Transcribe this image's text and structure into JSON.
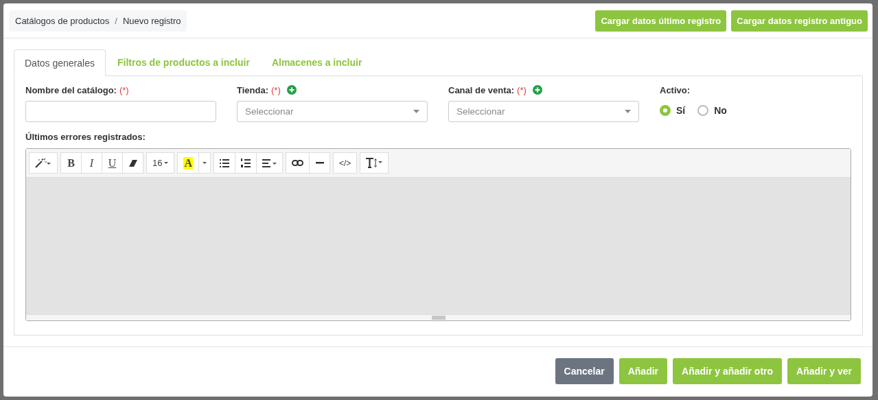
{
  "breadcrumb": [
    "Catálogos de productos",
    "Nuevo registro"
  ],
  "breadcrumb_separator": "/",
  "header_buttons": [
    "Cargar datos último registro",
    "Cargar datos registro antiguo"
  ],
  "tabs": [
    {
      "label": "Datos generales",
      "selected": true
    },
    {
      "label": "Filtros de productos a incluir",
      "selected": false
    },
    {
      "label": "Almacenes a incluir",
      "selected": false
    }
  ],
  "fields": [
    {
      "kind": "text",
      "label": "Nombre del catálogo:",
      "required": "(*)",
      "add": false
    },
    {
      "kind": "select",
      "label": "Tienda:",
      "required": "(*)",
      "add": true,
      "placeholder": "Seleccionar"
    },
    {
      "kind": "select",
      "label": "Canal de venta:",
      "required": "(*)",
      "add": true,
      "placeholder": "Seleccionar"
    },
    {
      "kind": "radio",
      "label": "Activo:",
      "options": [
        {
          "label": "Sí",
          "selected": true
        },
        {
          "label": "No",
          "selected": false
        }
      ]
    }
  ],
  "editor": {
    "label": "Últimos errores registrados:",
    "toolbar": [
      [
        {
          "kind": "magic"
        }
      ],
      [
        {
          "kind": "bold",
          "label": "B"
        },
        {
          "kind": "italic",
          "label": "I"
        },
        {
          "kind": "underline",
          "label": "U"
        },
        {
          "kind": "eraser"
        }
      ],
      [
        {
          "kind": "size",
          "label": "16"
        }
      ],
      [
        {
          "kind": "color",
          "label": "A"
        },
        {
          "kind": "caret"
        }
      ],
      [
        {
          "kind": "ul"
        },
        {
          "kind": "ol"
        },
        {
          "kind": "align"
        }
      ],
      [
        {
          "kind": "link"
        },
        {
          "kind": "hr"
        }
      ],
      [
        {
          "kind": "code",
          "label": "</>"
        }
      ],
      [
        {
          "kind": "height"
        }
      ]
    ]
  },
  "footer_buttons": [
    {
      "label": "Cancelar",
      "kind": "secondary"
    },
    {
      "label": "Añadir",
      "kind": "primary"
    },
    {
      "label": "Añadir y añadir otro",
      "kind": "primary"
    },
    {
      "label": "Añadir y ver",
      "kind": "primary"
    }
  ]
}
